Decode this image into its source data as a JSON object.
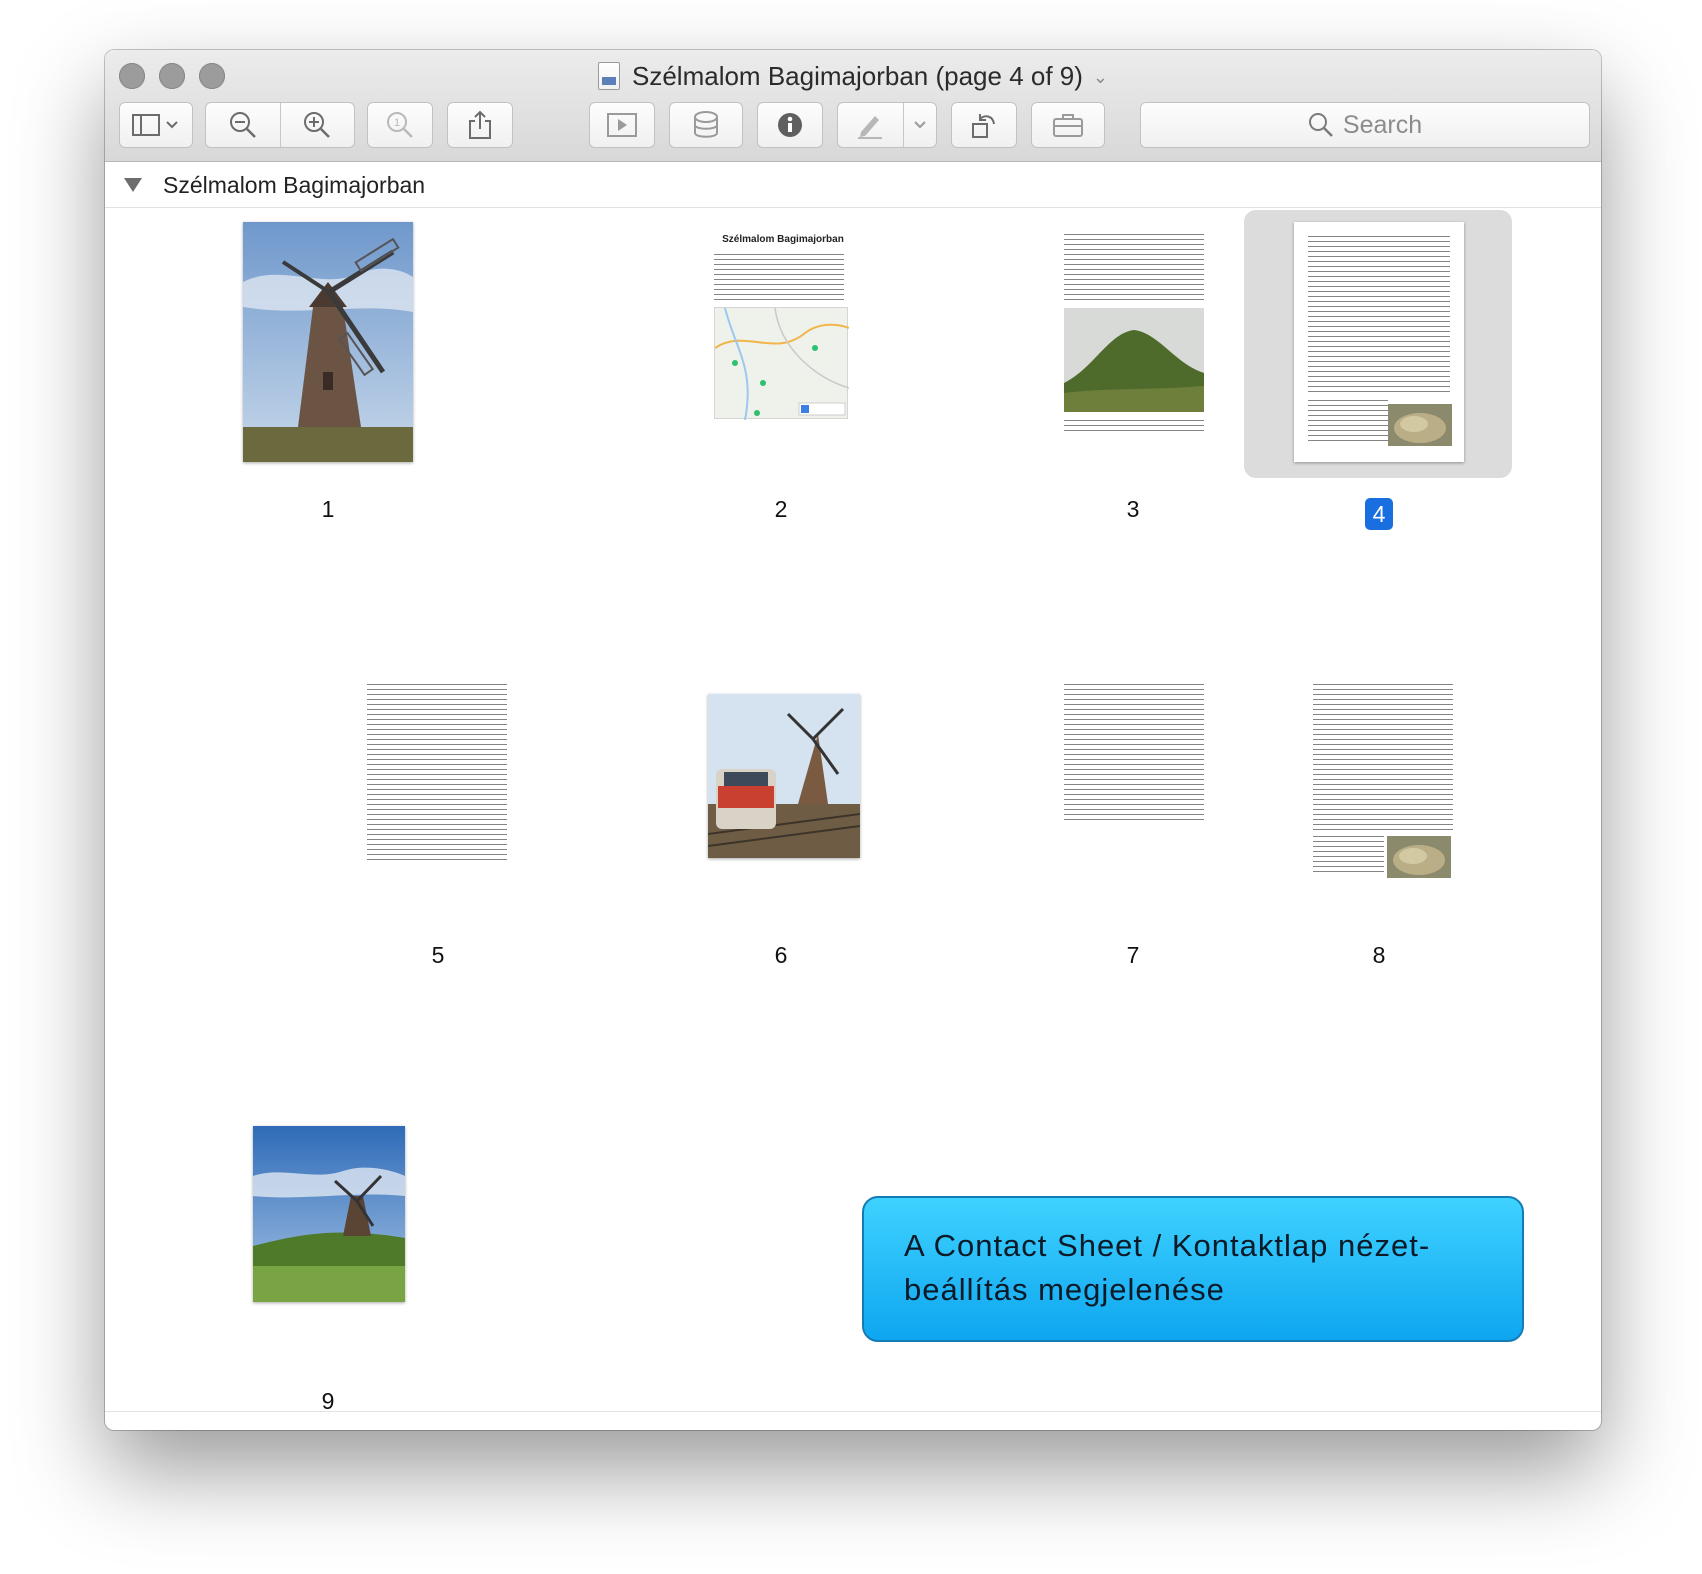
{
  "window": {
    "title": "Szélmalom Bagimajorban (page 4 of 9)",
    "title_chevron": "chevron-down-icon"
  },
  "toolbar": {
    "buttons": [
      {
        "name": "sidebar-view-menu",
        "icon": "sidebar-icon"
      },
      {
        "name": "zoom-out",
        "icon": "zoom-out-icon"
      },
      {
        "name": "zoom-in",
        "icon": "zoom-in-icon"
      },
      {
        "name": "actual-size",
        "icon": "zoom-actual-icon"
      },
      {
        "name": "share",
        "icon": "share-icon"
      },
      {
        "name": "slideshow",
        "icon": "play-icon"
      },
      {
        "name": "highlight-stack",
        "icon": "stack-icon"
      },
      {
        "name": "inspector",
        "icon": "info-icon"
      },
      {
        "name": "markup",
        "icon": "pen-icon"
      },
      {
        "name": "rotate",
        "icon": "rotate-icon"
      },
      {
        "name": "toolbox",
        "icon": "toolbox-icon"
      }
    ],
    "search_label": "Search"
  },
  "sidebar": {
    "section_title": "Szélmalom Bagimajorban"
  },
  "pages": [
    {
      "label": "1",
      "kind": "photo-windmill"
    },
    {
      "label": "2",
      "kind": "text-map",
      "heading": "Szélmalom Bagimajorban"
    },
    {
      "label": "3",
      "kind": "text-hill"
    },
    {
      "label": "4",
      "kind": "text-rock",
      "selected": true
    },
    {
      "label": "5",
      "kind": "text"
    },
    {
      "label": "6",
      "kind": "photo-train"
    },
    {
      "label": "7",
      "kind": "text-short"
    },
    {
      "label": "8",
      "kind": "text-rock"
    },
    {
      "label": "9",
      "kind": "photo-windmill-field"
    }
  ],
  "callout": {
    "text_line1": "A Contact Sheet / Kontaktlap nézet-",
    "text_line2": "beállítás megjelenése"
  },
  "colors": {
    "selection": "#1a6fe0",
    "callout_bg": "#1ab3f5"
  }
}
